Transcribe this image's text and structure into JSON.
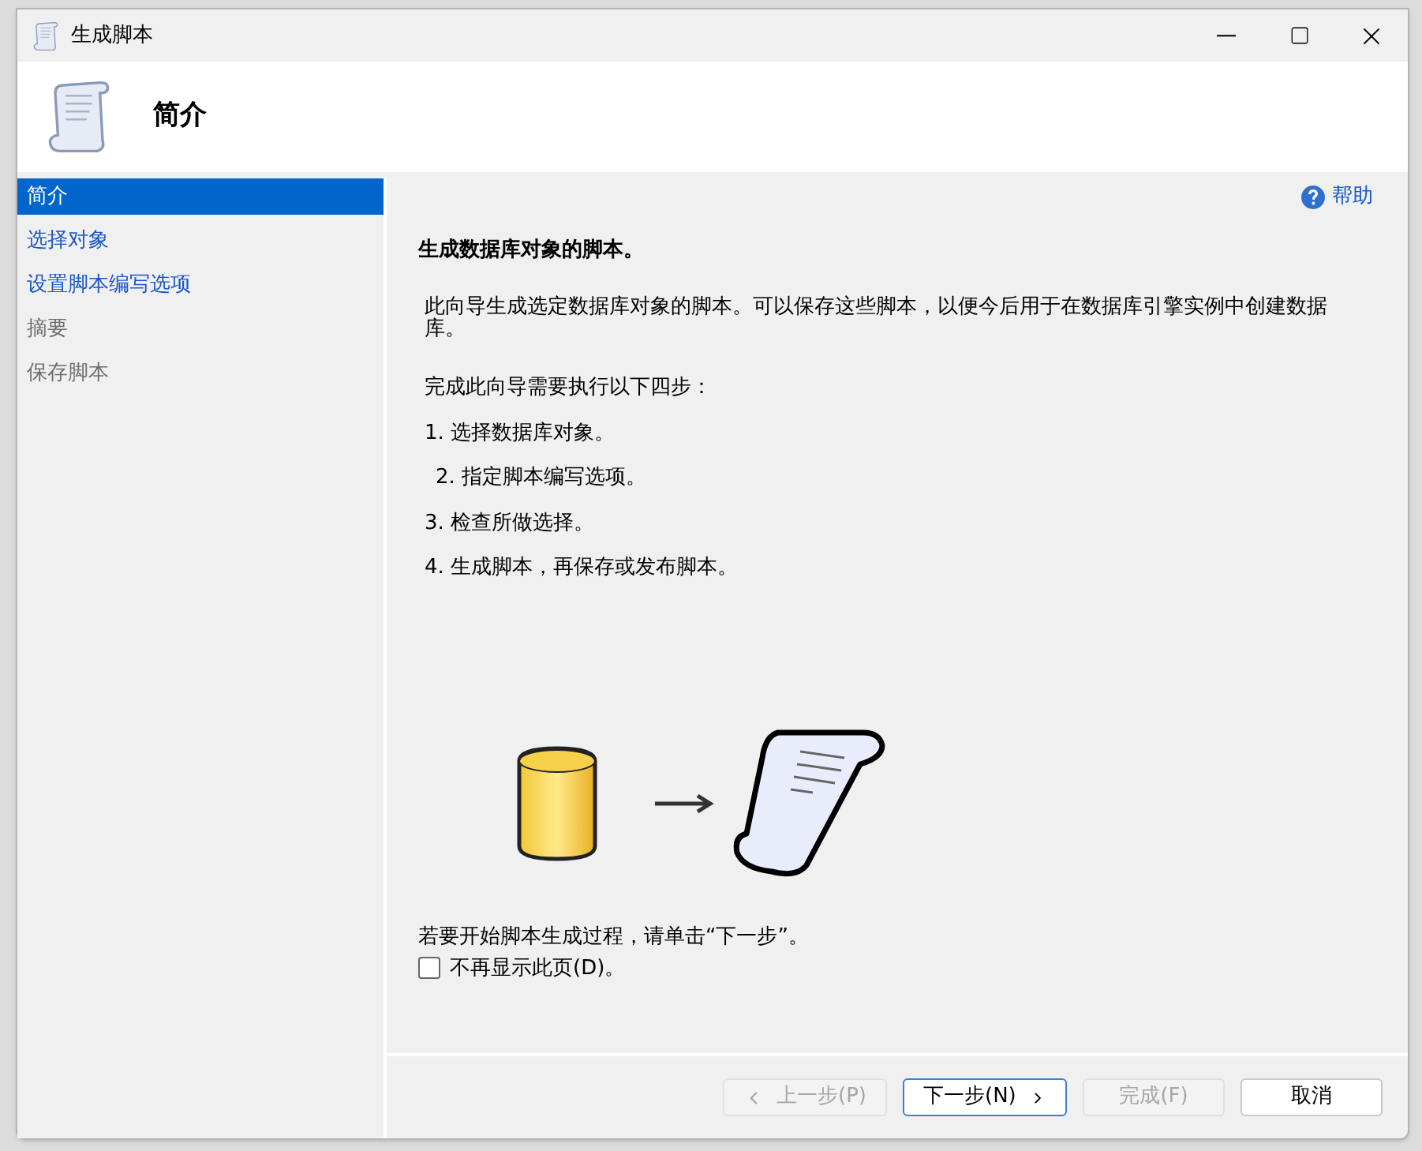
{
  "window": {
    "title": "生成脚本"
  },
  "header": {
    "title": "简介"
  },
  "sidebar": {
    "items": [
      {
        "label": "简介",
        "selected": true,
        "disabled": false
      },
      {
        "label": "选择对象",
        "selected": false,
        "disabled": false
      },
      {
        "label": "设置脚本编写选项",
        "selected": false,
        "disabled": false
      },
      {
        "label": "摘要",
        "selected": false,
        "disabled": true
      },
      {
        "label": "保存脚本",
        "selected": false,
        "disabled": true
      }
    ]
  },
  "help": {
    "label": "帮助"
  },
  "content": {
    "heading": "生成数据库对象的脚本。",
    "description": "此向导生成选定数据库对象的脚本。可以保存这些脚本，以便今后用于在数据库引擎实例中创建数据库。",
    "steps_intro": "完成此向导需要执行以下四步：",
    "steps": [
      "1. 选择数据库对象。",
      "2. 指定脚本编写选项。",
      "3. 检查所做选择。",
      "4. 生成脚本，再保存或发布脚本。"
    ],
    "start_hint": "若要开始脚本生成过程，请单击“下一步”。",
    "dont_show": {
      "label": "不再显示此页(D)。",
      "checked": false
    }
  },
  "buttons": [
    {
      "label": "上一步(P)",
      "kind": "back",
      "disabled": true,
      "focused": false
    },
    {
      "label": "下一步(N)",
      "kind": "next",
      "disabled": false,
      "focused": true
    },
    {
      "label": "完成(F)",
      "kind": "plain",
      "disabled": true,
      "focused": false
    },
    {
      "label": "取消",
      "kind": "plain",
      "disabled": false,
      "focused": false
    }
  ]
}
